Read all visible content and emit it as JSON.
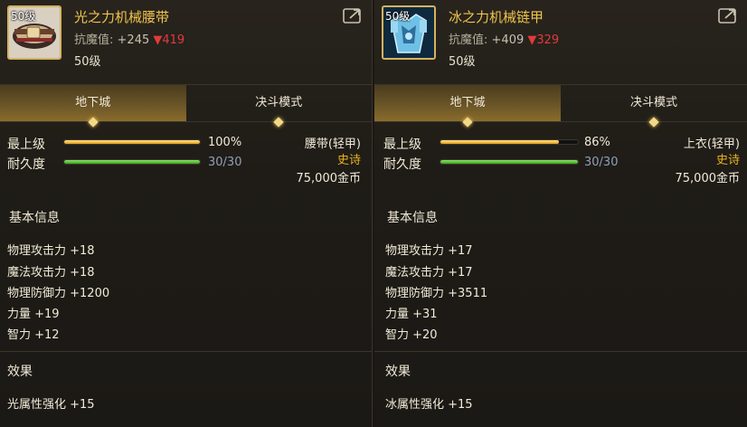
{
  "items": [
    {
      "level_tag": "50级",
      "name": "光之力机械腰带",
      "resist_label": "抗魔值:",
      "resist_value": "+245",
      "resist_down": "▼419",
      "level_line": "50级",
      "icon": "belt-icon",
      "tabs": [
        "地下城",
        "决斗模式"
      ],
      "stats_rows": {
        "max_upgrade_label": "最上级",
        "max_upgrade_pct": "100%",
        "max_upgrade_fraction": 1.0,
        "durability_label": "耐久度",
        "durability_value": "30/30",
        "durability_fraction": 1.0
      },
      "equip_type": "腰带(轻甲)",
      "rarity": "史诗",
      "price": "75,000金币",
      "basic_info_title": "基本信息",
      "basic_stats": [
        "物理攻击力 +18",
        "魔法攻击力 +18",
        "物理防御力 +1200",
        "力量 +19",
        "智力 +12"
      ],
      "effect_title": "效果",
      "effects": [
        "光属性强化 +15"
      ]
    },
    {
      "level_tag": "50级",
      "name": "冰之力机械链甲",
      "resist_label": "抗魔值:",
      "resist_value": "+409",
      "resist_down": "▼329",
      "level_line": "50级",
      "icon": "armor-icon",
      "tabs": [
        "地下城",
        "决斗模式"
      ],
      "stats_rows": {
        "max_upgrade_label": "最上级",
        "max_upgrade_pct": "86%",
        "max_upgrade_fraction": 0.86,
        "durability_label": "耐久度",
        "durability_value": "30/30",
        "durability_fraction": 1.0
      },
      "equip_type": "上衣(轻甲)",
      "rarity": "史诗",
      "price": "75,000金币",
      "basic_info_title": "基本信息",
      "basic_stats": [
        "物理攻击力 +17",
        "魔法攻击力 +17",
        "物理防御力 +3511",
        "力量 +31",
        "智力 +20"
      ],
      "effect_title": "效果",
      "effects": [
        "冰属性强化 +15"
      ]
    }
  ],
  "colors": {
    "name": "#f0c34d",
    "rarity": "#e9b11f",
    "down": "#e23b3b",
    "durability": "#8da0b8"
  }
}
